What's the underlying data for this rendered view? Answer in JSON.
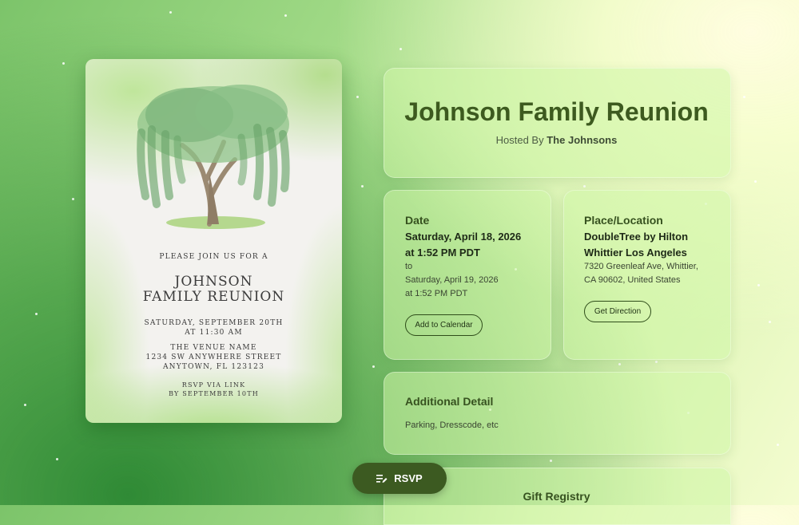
{
  "invitation": {
    "join_text": "PLEASE JOIN US FOR A",
    "title_line1": "JOHNSON",
    "title_line2": "FAMILY REUNION",
    "date_line": "SATURDAY, SEPTEMBER 20TH",
    "time_line": "AT 11:30 AM",
    "venue_name": "THE VENUE NAME",
    "venue_street": "1234 SW ANYWHERE STREET",
    "venue_city": "ANYTOWN, FL 123123",
    "rsvp_line1": "RSVP VIA LINK",
    "rsvp_line2": "BY SEPTEMBER 10TH"
  },
  "event": {
    "title": "Johnson Family Reunion",
    "hosted_prefix": "Hosted By",
    "host": "The Johnsons"
  },
  "date_card": {
    "heading": "Date",
    "start_date": "Saturday, April 18, 2026",
    "start_time": "at 1:52 PM PDT",
    "separator": "to",
    "end_date": "Saturday, April 19, 2026",
    "end_time": "at 1:52 PM PDT",
    "button_label": "Add to Calendar"
  },
  "location_card": {
    "heading": "Place/Location",
    "venue_line1": "DoubleTree by Hilton",
    "venue_line2": "Whittier Los Angeles",
    "address_line1": "7320 Greenleaf Ave, Whittier,",
    "address_line2": "CA 90602, United States",
    "button_label": "Get Direction"
  },
  "detail_card": {
    "heading": "Additional Detail",
    "text": "Parking, Dresscode, etc"
  },
  "gift_card": {
    "heading": "Gift Registry"
  },
  "rsvp_button": {
    "label": "RSVP",
    "icon": "list-edit-icon"
  },
  "colors": {
    "primary": "#3c5a21",
    "title": "#3d5a1f",
    "panel": "#cdf5a5"
  }
}
